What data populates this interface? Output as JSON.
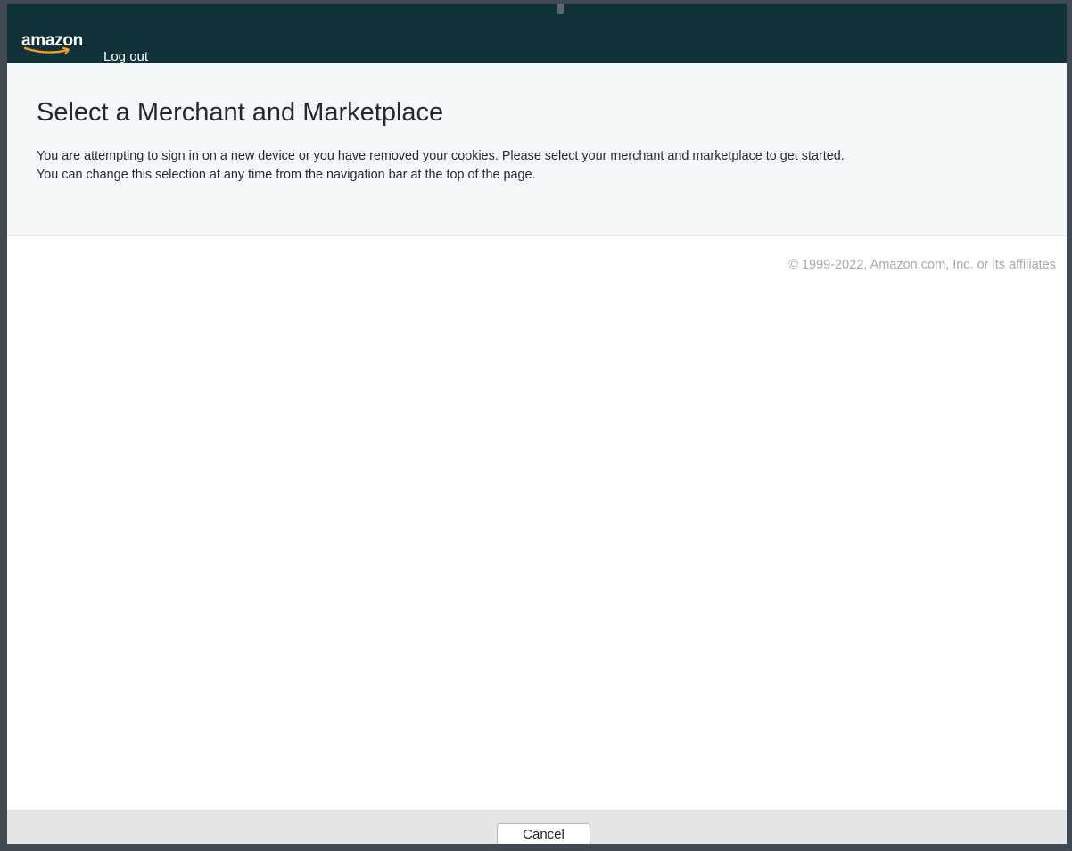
{
  "header": {
    "logo_text": "amazon",
    "logout_label": "Log out"
  },
  "main": {
    "title": "Select a Merchant and Marketplace",
    "description_line1": "You are attempting to sign in on a new device or you have removed your cookies. Please select your merchant and marketplace to get started.",
    "description_line2": "You can change this selection at any time from the navigation bar at the top of the page."
  },
  "footer": {
    "copyright": "© 1999-2022, Amazon.com, Inc. or its affiliates"
  },
  "dialog": {
    "cancel_label": "Cancel"
  },
  "colors": {
    "header_bg": "#12323a",
    "hero_bg": "#f4f7f8",
    "smile": "#f7a01d"
  },
  "icons": {
    "logo_smile": "amazon-smile-arrow"
  }
}
